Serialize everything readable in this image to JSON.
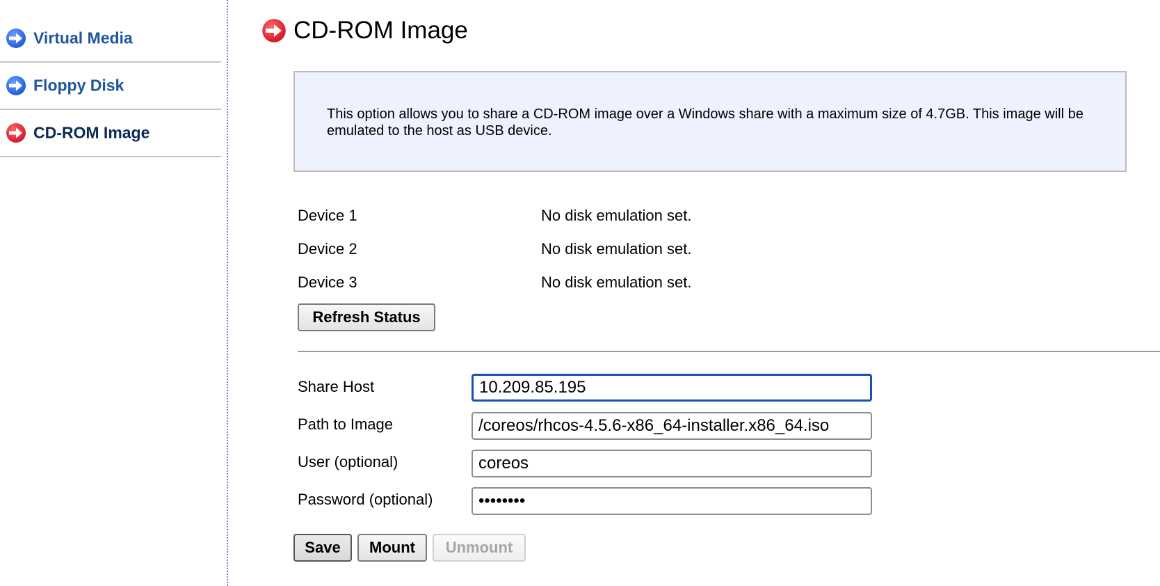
{
  "sidebar": {
    "items": [
      {
        "label": "Virtual Media",
        "active": false
      },
      {
        "label": "Floppy Disk",
        "active": false
      },
      {
        "label": "CD-ROM Image",
        "active": true
      }
    ]
  },
  "main": {
    "title": "CD-ROM Image",
    "info": "This option allows you to share a CD-ROM image over a Windows share with a maximum size of 4.7GB. This image will be emulated to the host as USB device.",
    "devices": [
      {
        "label": "Device 1",
        "status": "No disk emulation set."
      },
      {
        "label": "Device 2",
        "status": "No disk emulation set."
      },
      {
        "label": "Device 3",
        "status": "No disk emulation set."
      }
    ],
    "refresh_label": "Refresh Status",
    "form": {
      "share_host": {
        "label": "Share Host",
        "value": "10.209.85.195"
      },
      "path": {
        "label": "Path to Image",
        "value": "/coreos/rhcos-4.5.6-x86_64-installer.x86_64.iso"
      },
      "user": {
        "label": "User (optional)",
        "value": "coreos"
      },
      "password": {
        "label": "Password (optional)",
        "value": "********"
      }
    },
    "buttons": {
      "save": "Save",
      "mount": "Mount",
      "unmount": "Unmount"
    }
  },
  "colors": {
    "nav_link": "#1e56a0",
    "nav_active": "#0a2a57",
    "blue_arrow": "#2f6ee0",
    "red_arrow": "#e0192b",
    "info_bg": "#eef2fe",
    "focus_border": "#1b4fb5"
  },
  "icons": {
    "nav_inactive": "blue-arrow-right-icon",
    "nav_active": "red-arrow-right-icon",
    "title": "red-arrow-right-icon"
  }
}
